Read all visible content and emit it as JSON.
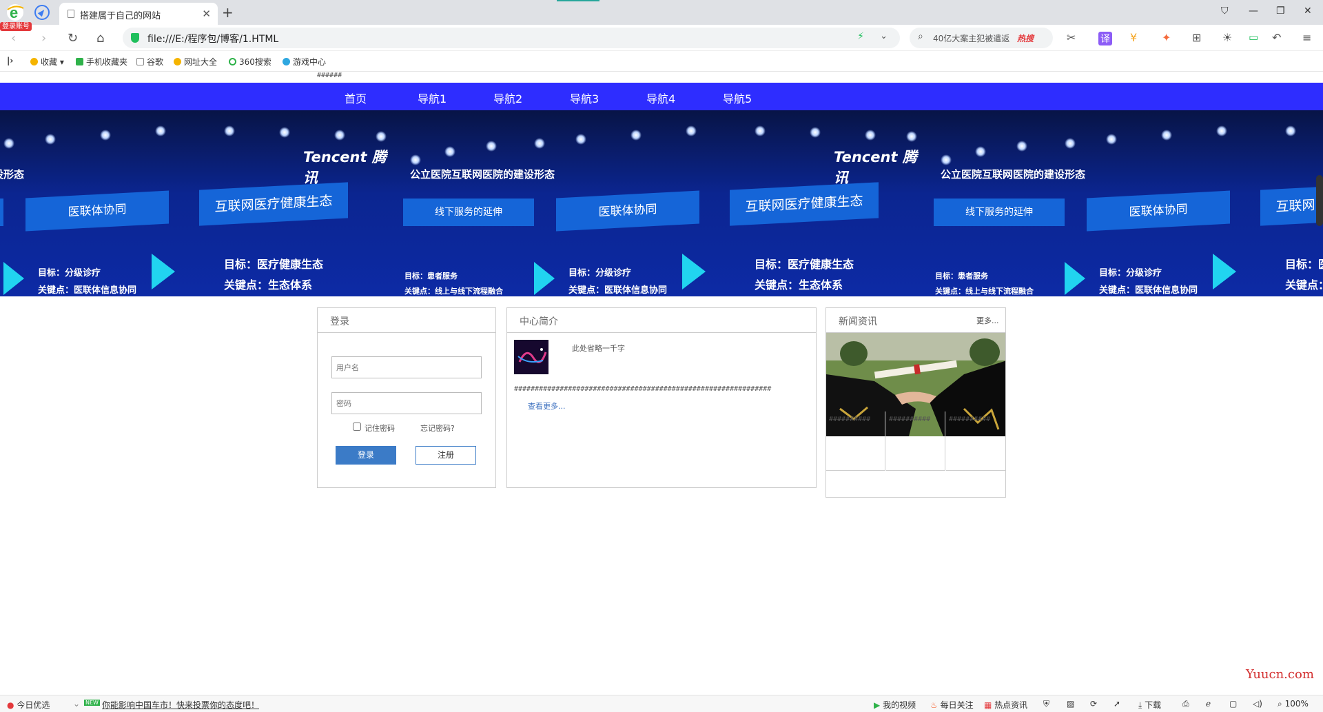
{
  "browser": {
    "login_tag": "登录账号",
    "tab_title": "搭建属于自己的网站",
    "address_url": "file:///E:/程序包/博客/1.HTML",
    "search_text": "40亿大案主犯被遣返",
    "search_hot": "热搜",
    "zoom": "100%"
  },
  "bookmarks": [
    "收藏",
    "手机收藏夹",
    "谷歌",
    "网址大全",
    "360搜索",
    "游戏中心"
  ],
  "page": {
    "top_hashes": "######",
    "nav": [
      "首页",
      "导航1",
      "导航2",
      "导航3",
      "导航4",
      "导航5"
    ],
    "banner": {
      "brand": "Tencent 腾讯",
      "box_eco": "互联网医疗健康生态",
      "box_collab": "医联体协同",
      "box_hospital": "公立医院互联网医院的建设形态",
      "box_offline": "线下服务的延伸",
      "goal_eco": "目标：医疗健康生态",
      "key_eco": "关键点：生态体系",
      "goal_collab": "目标：分级诊疗",
      "key_collab": "关键点：医联体信息协同",
      "goal_offline": "目标：患者服务",
      "key_offline": "关键点：线上与线下流程融合"
    },
    "login": {
      "title": "登录",
      "username_placeholder": "用户名",
      "password_placeholder": "密码",
      "remember": "记住密码",
      "forgot": "忘记密码?",
      "login_btn": "登录",
      "register_btn": "注册"
    },
    "intro": {
      "title": "中心简介",
      "summary": "此处省略一千字",
      "hashes": "##############################################################",
      "more": "查看更多..."
    },
    "news": {
      "title": "新闻资讯",
      "more": "更多...",
      "items": [
        "##########",
        "##########",
        "##########"
      ]
    },
    "watermark": "Yuucn.com"
  },
  "statusbar": {
    "today": "今日优选",
    "news_badge": "NEW",
    "ticker": "你能影响中国车市！快来投票你的态度吧！",
    "my_video": "我的视频",
    "daily": "每日关注",
    "hot_news": "热点资讯",
    "download": "下载",
    "zoom": "100%"
  }
}
